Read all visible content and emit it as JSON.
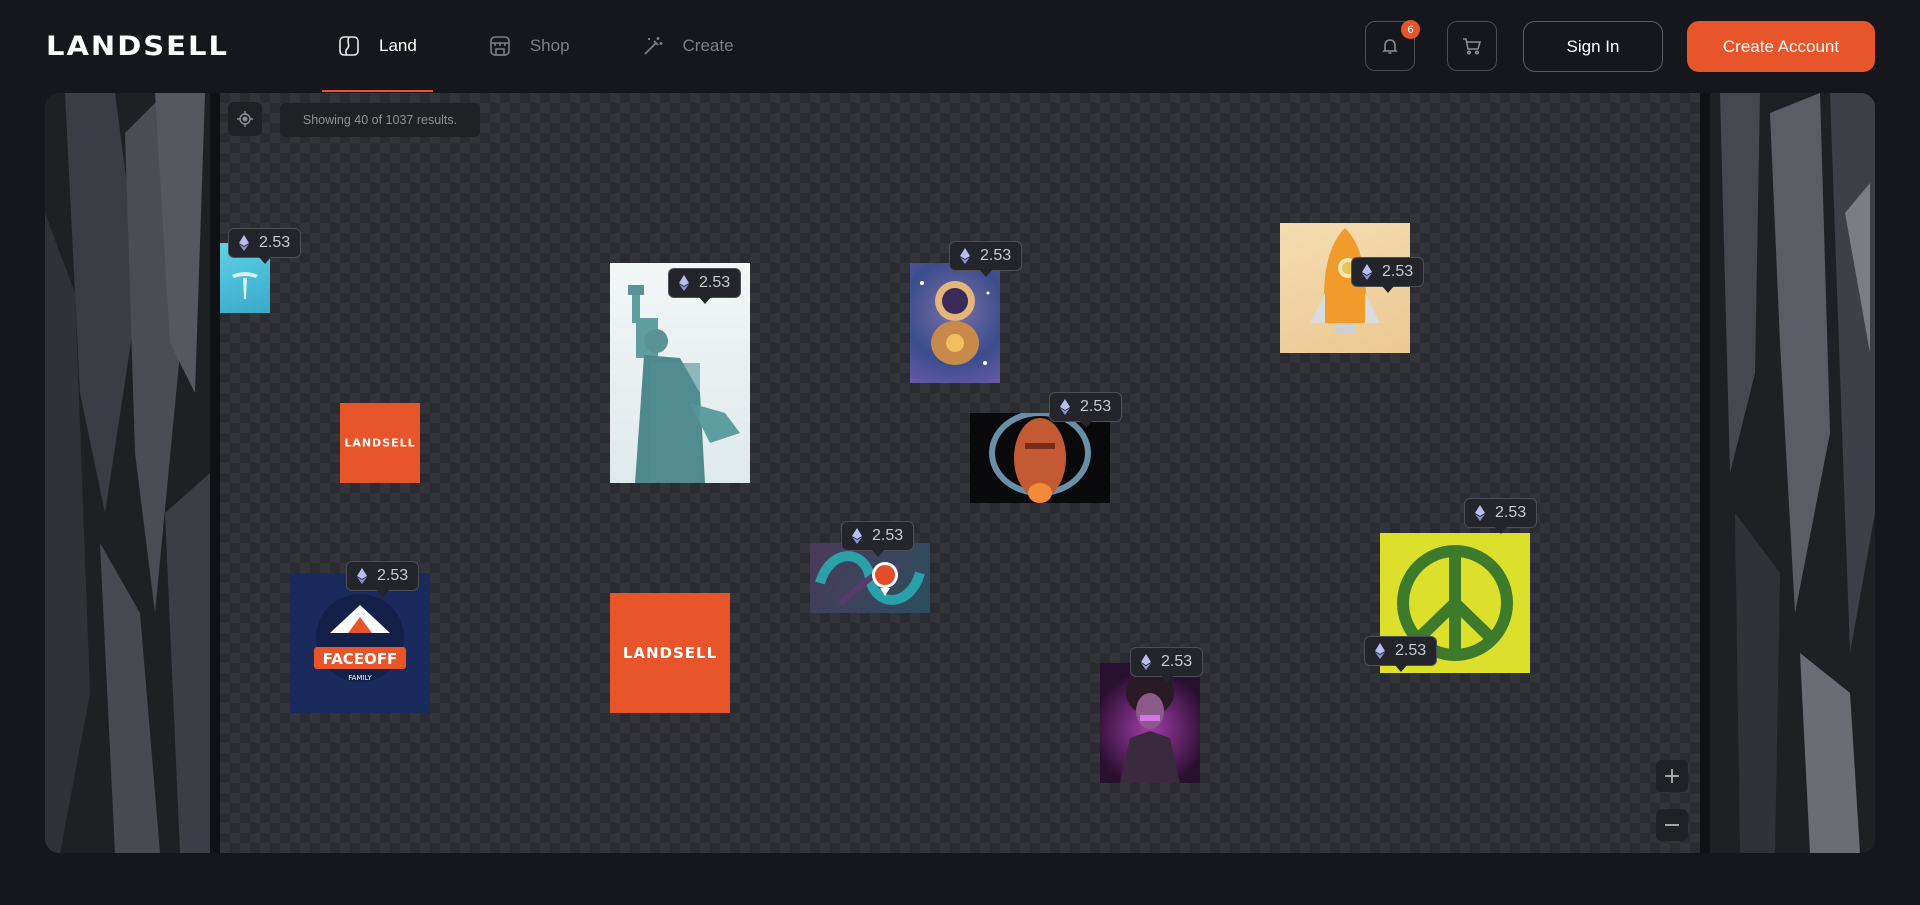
{
  "header": {
    "logo": "LANDSELL",
    "nav": [
      {
        "label": "Land",
        "icon": "land-icon",
        "active": true
      },
      {
        "label": "Shop",
        "icon": "shop-icon",
        "active": false
      },
      {
        "label": "Create",
        "icon": "magic-wand-icon",
        "active": false
      }
    ],
    "notifications": {
      "icon": "bell-icon",
      "count": "6"
    },
    "cart": {
      "icon": "cart-icon"
    },
    "sign_in_label": "Sign In",
    "create_account_label": "Create Account"
  },
  "map": {
    "results_text": "Showing 40 of 1037 results.",
    "locate_icon": "crosshair-icon",
    "zoom_in_icon": "plus-icon",
    "zoom_out_icon": "minus-icon",
    "currency_icon": "ethereum-icon",
    "tiles": [
      {
        "name": "tesla",
        "description": "Tesla logo tile"
      },
      {
        "name": "statue-of-liberty",
        "description": "Statue of Liberty pixel art"
      },
      {
        "name": "astronaut",
        "description": "Astronaut artwork"
      },
      {
        "name": "rocket",
        "description": "Orange rocket artwork"
      },
      {
        "name": "landsell-small",
        "label": "LANDSELL"
      },
      {
        "name": "robot-head",
        "description": "Robot head artwork"
      },
      {
        "name": "peace-sign",
        "description": "Green peace sign"
      },
      {
        "name": "faceoff",
        "label": "FACEOFF",
        "sublabel": "FAMILY"
      },
      {
        "name": "landsell-large",
        "label": "LANDSELL"
      },
      {
        "name": "loop",
        "description": "Loop artwork"
      },
      {
        "name": "purple-character",
        "description": "Purple character artwork"
      }
    ],
    "prices": [
      {
        "for": "tesla",
        "value": "2.53"
      },
      {
        "for": "statue-of-liberty",
        "value": "2.53"
      },
      {
        "for": "astronaut",
        "value": "2.53"
      },
      {
        "for": "rocket",
        "value": "2.53"
      },
      {
        "for": "robot-head",
        "value": "2.53"
      },
      {
        "for": "peace-sign",
        "value": "2.53"
      },
      {
        "for": "loop",
        "value": "2.53"
      },
      {
        "for": "faceoff",
        "value": "2.53"
      },
      {
        "for": "purple-character",
        "value": "2.53"
      },
      {
        "for": "peace-sign-lower",
        "value": "2.53"
      }
    ],
    "colors": {
      "accent": "#e8552a",
      "background": "#15171c"
    }
  }
}
